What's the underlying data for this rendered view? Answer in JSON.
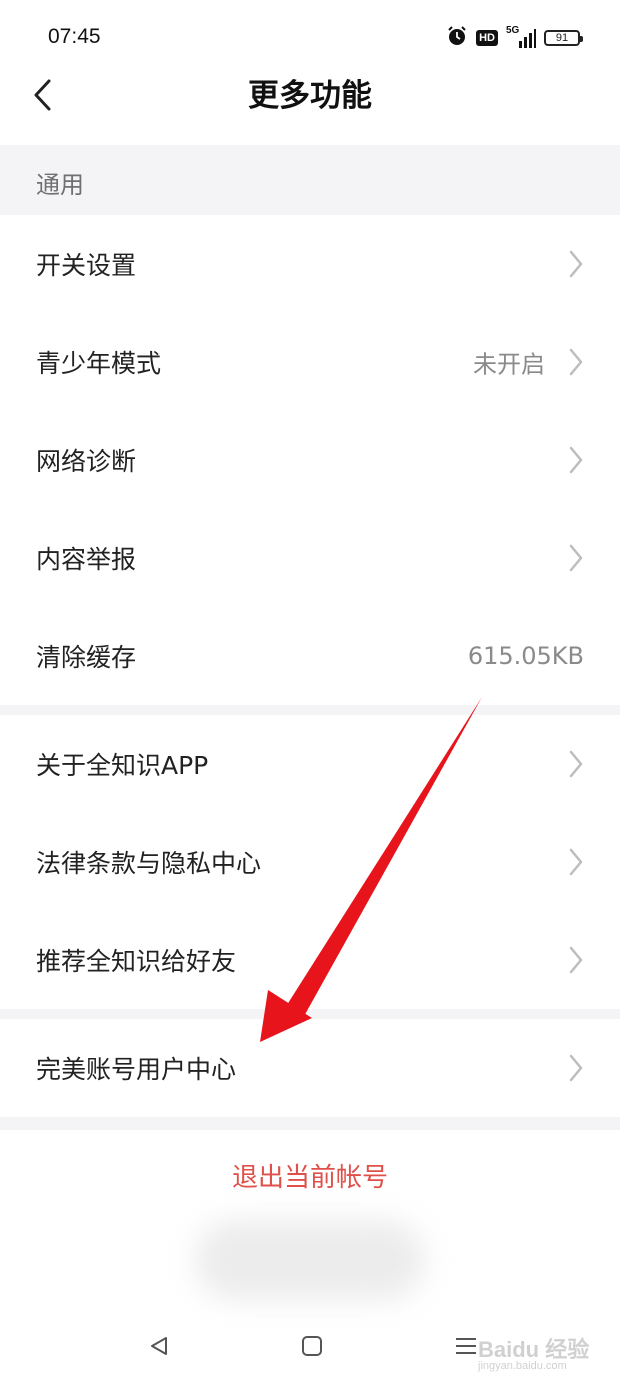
{
  "status_bar": {
    "time": "07:45",
    "hd_label": "HD",
    "network_label": "5G",
    "battery_level": "91",
    "icons": [
      "alarm-icon",
      "hd-icon",
      "signal-5g-icon",
      "battery-icon"
    ]
  },
  "nav": {
    "title": "更多功能",
    "back_icon": "chevron-left-icon"
  },
  "sections": {
    "general_header": "通用"
  },
  "settings": {
    "switch_settings": {
      "label": "开关设置"
    },
    "teen_mode": {
      "label": "青少年模式",
      "value": "未开启"
    },
    "network_diagnosis": {
      "label": "网络诊断"
    },
    "content_report": {
      "label": "内容举报"
    },
    "clear_cache": {
      "label": "清除缓存",
      "value": "615.05KB"
    },
    "about": {
      "label": "关于全知识APP"
    },
    "legal": {
      "label": "法律条款与隐私中心"
    },
    "recommend": {
      "label": "推荐全知识给好友"
    },
    "user_center": {
      "label": "完美账号用户中心"
    }
  },
  "logout": {
    "label": "退出当前帐号"
  },
  "system_nav": {
    "icons": [
      "back-triangle-icon",
      "home-square-icon",
      "menu-lines-icon"
    ]
  },
  "watermark": {
    "main": "Baidu 经验",
    "sub": "jingyan.baidu.com"
  },
  "colors": {
    "background": "#ffffff",
    "section_bg": "#f4f4f6",
    "logout_red": "#e0504a",
    "annotation_arrow": "#e8141b"
  }
}
